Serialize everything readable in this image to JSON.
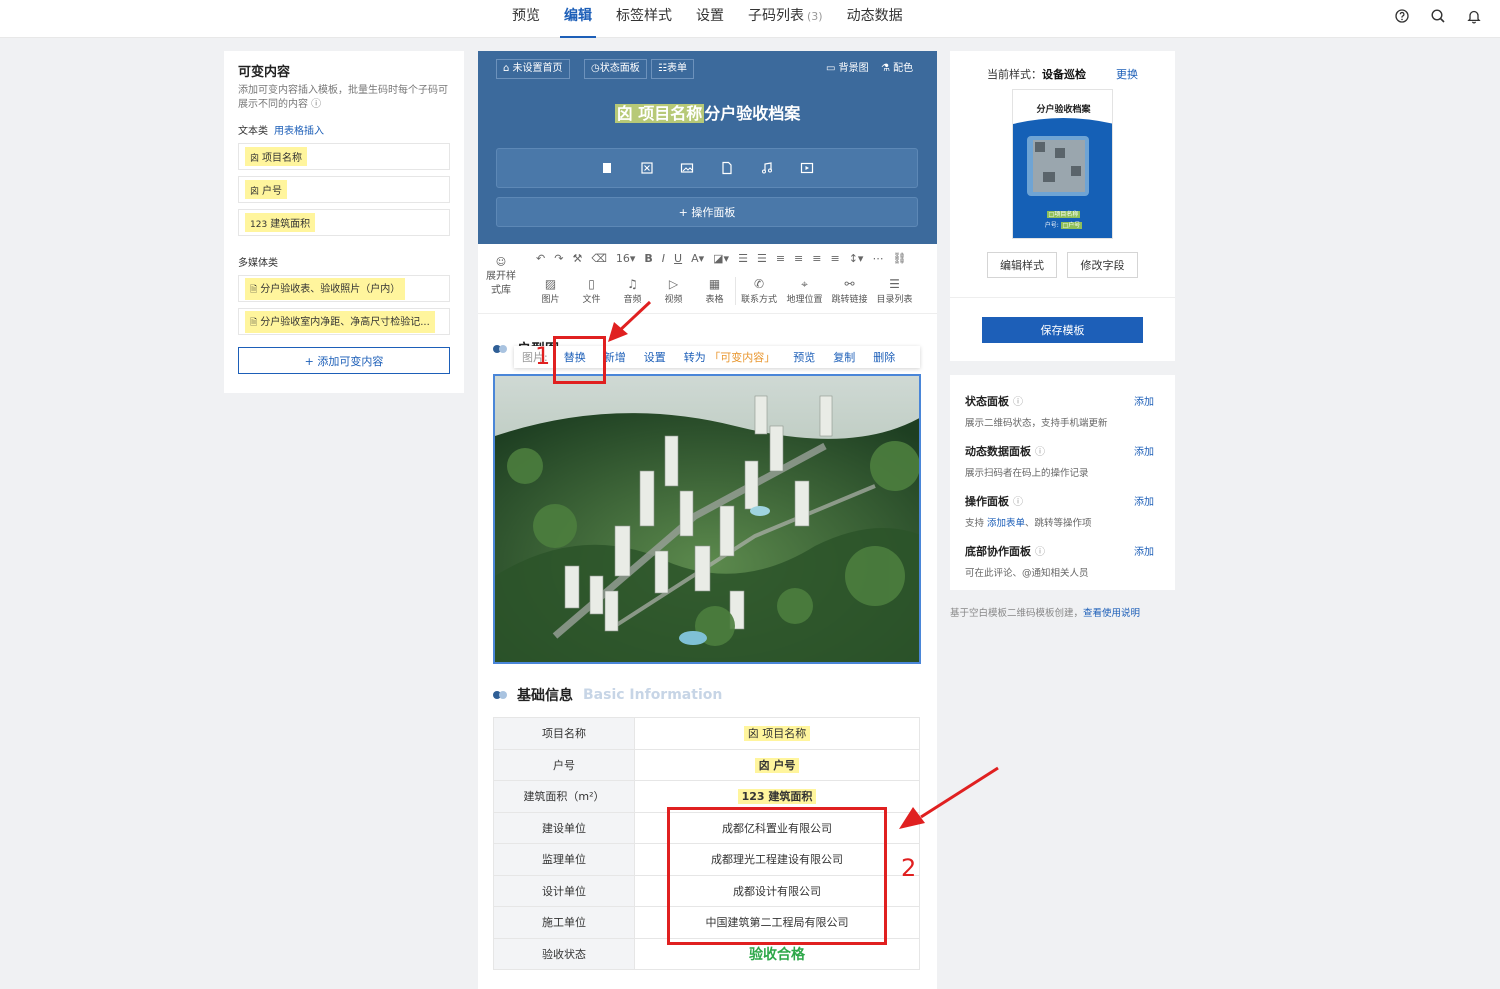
{
  "nav": {
    "tabs": [
      {
        "label": "预览"
      },
      {
        "label": "编辑"
      },
      {
        "label": "标签样式"
      },
      {
        "label": "设置"
      },
      {
        "label": "子码列表",
        "count": "(3)"
      },
      {
        "label": "动态数据"
      }
    ]
  },
  "left": {
    "title": "可变内容",
    "desc": "添加可变内容插入模板，批量生码时每个子码可展示不同的内容 ⓘ",
    "text_section": "文本类",
    "text_link": "用表格插入",
    "text_items": [
      "项目名称",
      "户号",
      "建筑面积"
    ],
    "text_icons": [
      "囟",
      "囟",
      "123"
    ],
    "media_section": "多媒体类",
    "media_items": [
      "分户验收表、验收照片（户内）",
      "分户验收室内净距、净高尺寸检验记..."
    ],
    "add_button": "+ 添加可变内容"
  },
  "banner": {
    "btn_home": "⌂ 未设置首页",
    "btn_status": "◷状态面板",
    "btn_form": "☷表单",
    "btn_bg": "▭ 背景图",
    "btn_color": "⚗ 配色",
    "title_var": "囟 项目名称",
    "title_rest": "分户验收档案",
    "panel_button": "+ 操作面板"
  },
  "toolbar": {
    "expand_label": "展开样式库",
    "font_size": "16",
    "insert": [
      {
        "glyph": "▨",
        "label": "图片"
      },
      {
        "glyph": "▯",
        "label": "文件"
      },
      {
        "glyph": "♫",
        "label": "音频"
      },
      {
        "glyph": "▷",
        "label": "视频"
      },
      {
        "glyph": "▦",
        "label": "表格"
      },
      {
        "glyph": "✆",
        "label": "联系方式"
      },
      {
        "glyph": "⌖",
        "label": "地理位置"
      },
      {
        "glyph": "⚯",
        "label": "跳转链接"
      },
      {
        "glyph": "☰",
        "label": "目录列表"
      }
    ]
  },
  "image_section": {
    "title": "户型图",
    "toolbar_label": "图片:",
    "actions": [
      "替换",
      "新增",
      "设置",
      "转为",
      "预览",
      "复制",
      "删除"
    ],
    "convert_target": "「可变内容」"
  },
  "basic": {
    "title": "基础信息",
    "title_en": "Basic Information",
    "rows": [
      {
        "key": "项目名称",
        "value": "囟 项目名称"
      },
      {
        "key": "户号",
        "value": "囟 户号"
      },
      {
        "key": "建筑面积（m²）",
        "value": "123 建筑面积"
      },
      {
        "key": "建设单位",
        "value": "成都亿科置业有限公司"
      },
      {
        "key": "监理单位",
        "value": "成都理光工程建设有限公司"
      },
      {
        "key": "设计单位",
        "value": "成都设计有限公司"
      },
      {
        "key": "施工单位",
        "value": "中国建筑第二工程局有限公司"
      },
      {
        "key": "验收状态",
        "value": "验收合格"
      }
    ]
  },
  "annotations": {
    "one": "1",
    "two": "2"
  },
  "right": {
    "style_label": "当前样式：",
    "style_name": "设备巡检",
    "change": "更换",
    "thumb_title": "分户验收档案",
    "thumb_line1": "□项目名称",
    "thumb_line2_prefix": "户号:",
    "thumb_line2_chip": "□户号",
    "edit_style": "编辑样式",
    "edit_fields": "修改字段",
    "save": "保存模板",
    "panels": [
      {
        "title": "状态面板",
        "desc": "展示二维码状态，支持手机端更新",
        "add": "添加"
      },
      {
        "title": "动态数据面板",
        "desc": "展示扫码者在码上的操作记录",
        "add": "添加"
      },
      {
        "title": "操作面板",
        "desc_prefix": "支持 ",
        "desc_link": "添加表单",
        "desc_suffix": "、跳转等操作项",
        "add": "添加"
      },
      {
        "title": "底部协作面板",
        "desc": "可在此评论、@通知相关人员",
        "add": "添加"
      }
    ],
    "footer_text": "基于空白模板二维码模板创建，",
    "footer_link": "查看使用说明"
  },
  "colors": {
    "accent": "#1d5fb8",
    "banner": "#3c6a9c",
    "annotation": "#e02020",
    "ok": "#2ea84a"
  }
}
